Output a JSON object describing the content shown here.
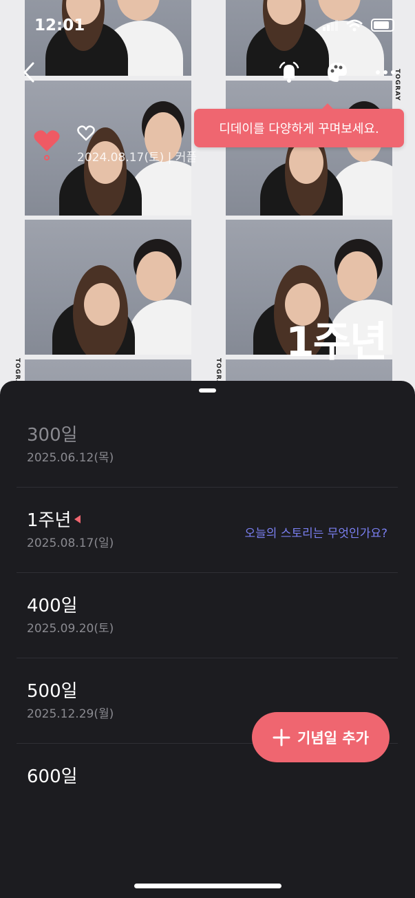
{
  "status_bar": {
    "time": "12:01"
  },
  "tooltip": {
    "text": "디데이를 다양하게 꾸며보세요."
  },
  "couple": {
    "date": "2024.08.17(토)  |  커플"
  },
  "photo": {
    "anniversary_overlay": "1주년",
    "watermark": "TOGRAY"
  },
  "anniversaries": [
    {
      "title": "300일",
      "date": "2025.06.12(목)",
      "past": true
    },
    {
      "title": "1주년",
      "date": "2025.08.17(일)",
      "link": "오늘의 스토리는 무엇인가요?"
    },
    {
      "title": "400일",
      "date": "2025.09.20(토)"
    },
    {
      "title": "500일",
      "date": "2025.12.29(월)"
    },
    {
      "title": "600일",
      "date": ""
    }
  ],
  "add_button": {
    "label": "기념일 추가"
  },
  "colors": {
    "accent": "#ef6670",
    "link": "#7a7ff0",
    "sheet_bg": "#1c1c20"
  }
}
